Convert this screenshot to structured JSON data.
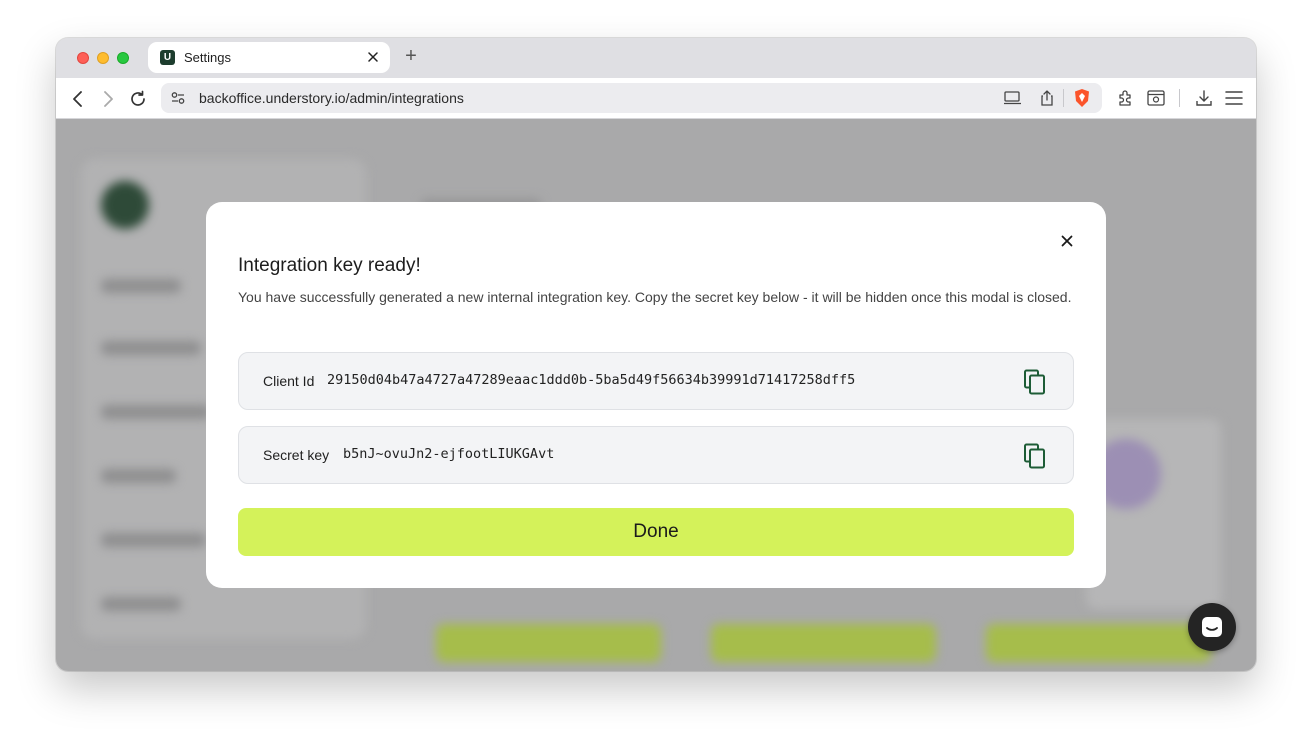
{
  "browser": {
    "tab": {
      "favicon_letter": "U",
      "title": "Settings"
    },
    "new_tab_symbol": "+",
    "url": "backoffice.understory.io/admin/integrations"
  },
  "modal": {
    "title": "Integration key ready!",
    "description": "You have successfully generated a new internal integration key. Copy the secret key below - it will be hidden once this modal is closed.",
    "client_id": {
      "label": "Client Id",
      "value": "29150d04b47a4727a47289eaac1ddd0b-5ba5d49f56634b39991d71417258dff5"
    },
    "secret_key": {
      "label": "Secret key",
      "value": "b5nJ~ovuJn2-ejfootLIUKGAvt"
    },
    "done_label": "Done"
  },
  "colors": {
    "accent": "#d4f25a",
    "copy_icon": "#1d5c36",
    "overlay": "#a9a9aa"
  }
}
